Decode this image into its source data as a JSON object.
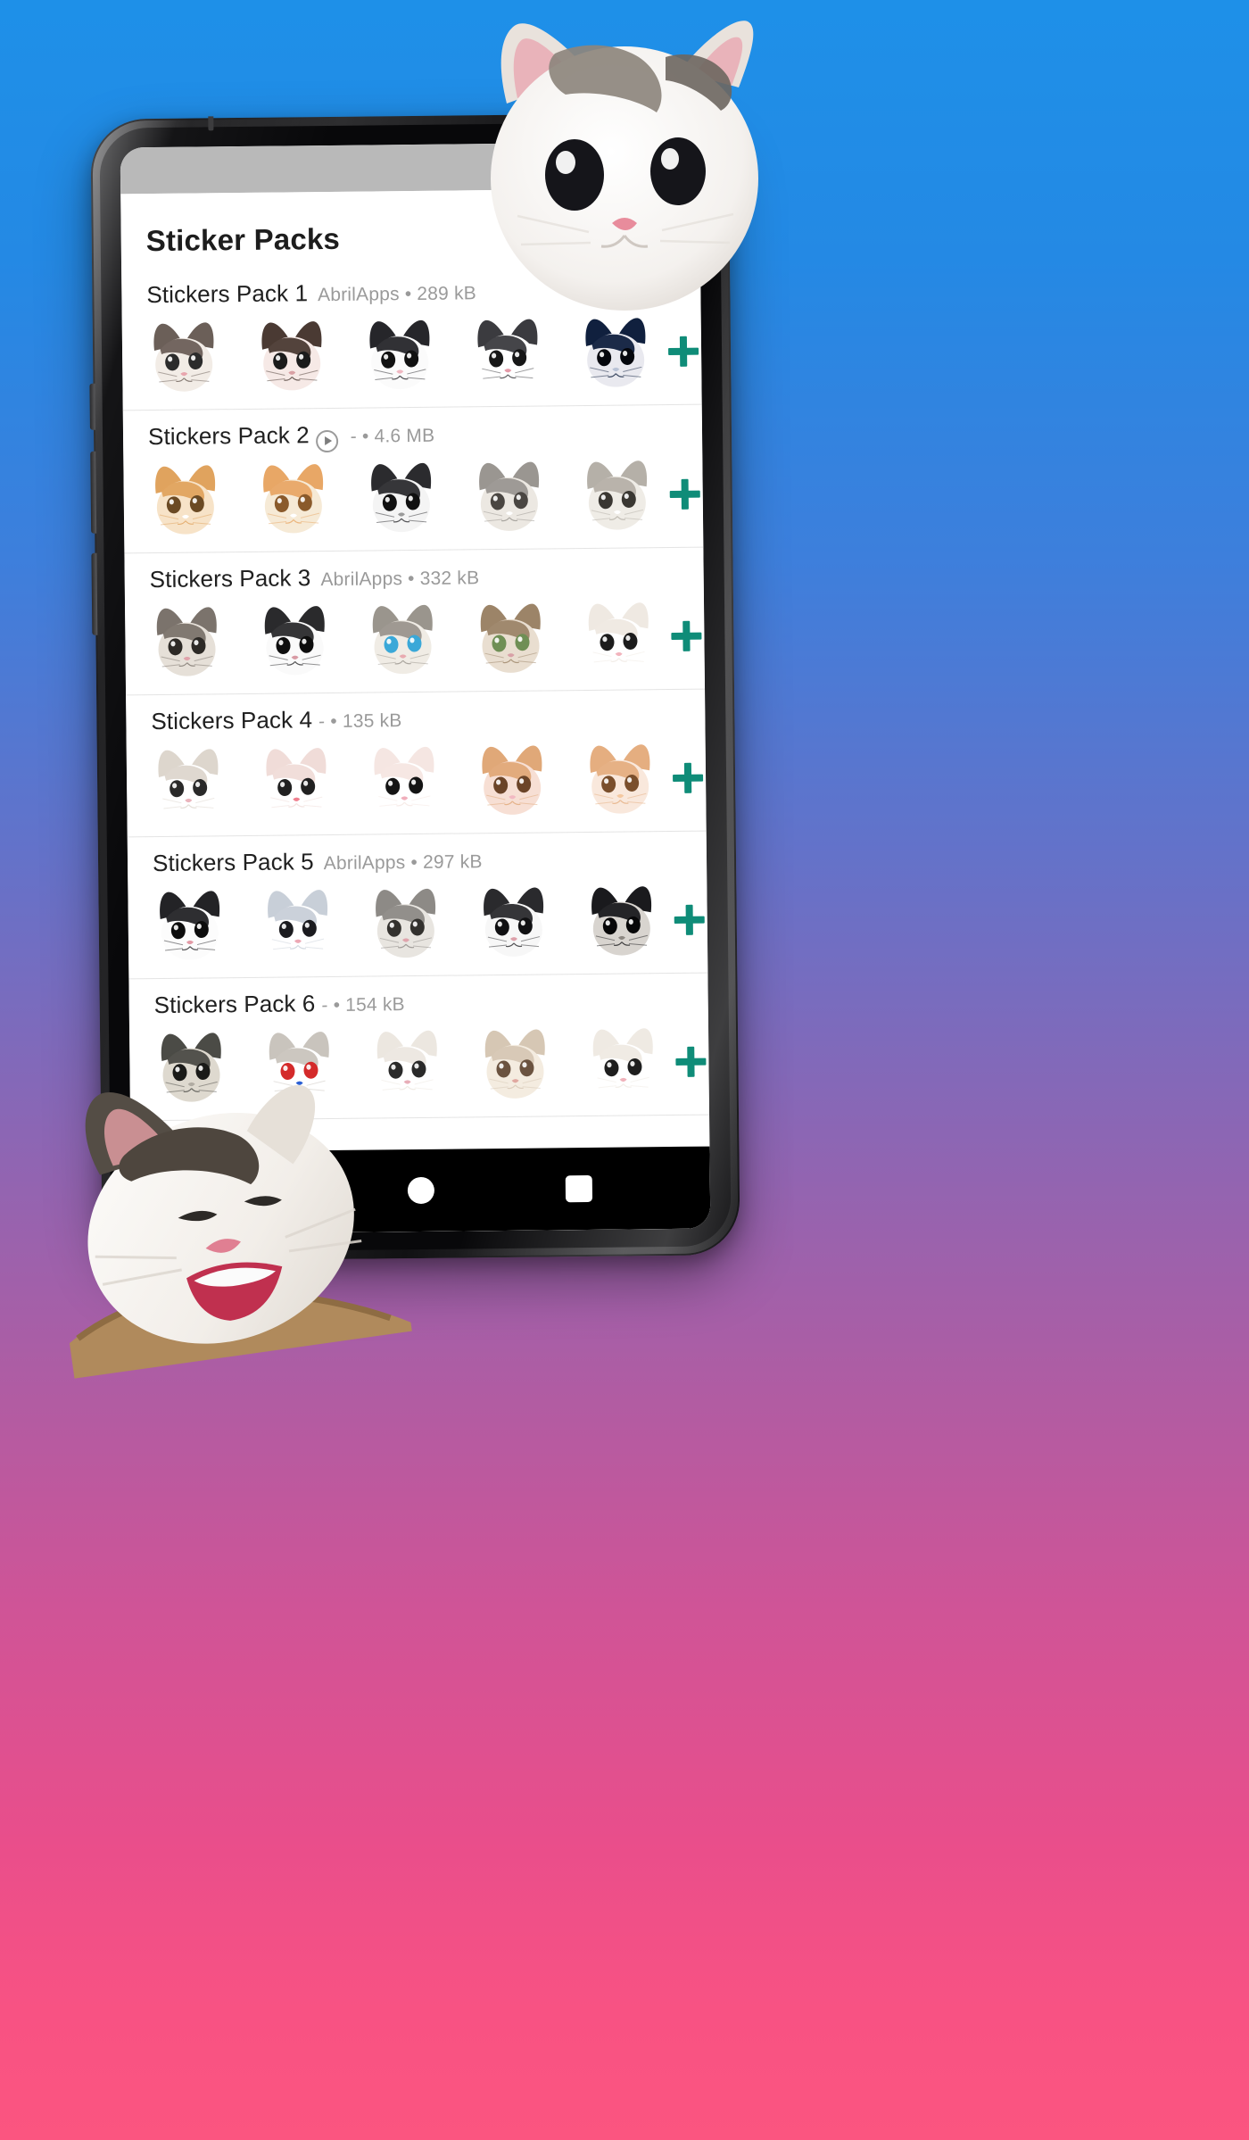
{
  "background": {
    "gradient_top": "#1E90E8",
    "gradient_mid": "#8C66B4",
    "gradient_bottom": "#FB5580"
  },
  "device": {
    "type": "android-phone-mockup",
    "frame_color": "#1D1D1F",
    "statusbar_color": "#B9B9B9"
  },
  "app": {
    "title": "Sticker Packs",
    "accent_color": "#0F8C78",
    "meta_color": "#9A9A9A"
  },
  "packs": [
    {
      "name": "Stickers Pack 1",
      "publisher": "AbrilApps",
      "separator": "•",
      "size": "289 kB",
      "meta": "AbrilApps • 289 kB",
      "animated": false,
      "add_label": "+",
      "stickers": [
        {
          "alt": "grey-and-white-kitten-sticker",
          "colors": [
            "#6b5f58",
            "#f2ece6",
            "#2b2b2b",
            "#e8a5ad"
          ]
        },
        {
          "alt": "dark-brown-kitten-wide-eyes-sticker",
          "colors": [
            "#4a3a33",
            "#f6e9e6",
            "#1b1b1b",
            "#d9a0a4"
          ]
        },
        {
          "alt": "black-and-white-cat-pink-nose-sticker",
          "colors": [
            "#26262a",
            "#fbfbfb",
            "#111111",
            "#f0b8c2"
          ]
        },
        {
          "alt": "tuxedo-cat-upright-ears-sticker",
          "colors": [
            "#3b3b3f",
            "#ffffff",
            "#171717",
            "#e59aa8"
          ]
        },
        {
          "alt": "black-cat-on-blue-background-sticker",
          "colors": [
            "#10203e",
            "#e9e9ef",
            "#05070d",
            "#b9c3d6"
          ]
        }
      ]
    },
    {
      "name": "Stickers Pack 2",
      "publisher": "-",
      "separator": "•",
      "size": "4.6 MB",
      "meta": "- • 4.6 MB",
      "animated": true,
      "animated_icon": "play-circle-icon",
      "add_label": "+",
      "stickers": [
        {
          "alt": "orange-tabby-cat-smiling-sticker",
          "colors": [
            "#e0a35e",
            "#f7e3c8",
            "#6b4a24",
            "#ffffff"
          ]
        },
        {
          "alt": "ginger-kitten-on-table-sticker",
          "colors": [
            "#e8a766",
            "#f6ead6",
            "#8a5a2b",
            "#ffffff"
          ]
        },
        {
          "alt": "tuxedo-cat-standing-sticker",
          "colors": [
            "#2b2b2e",
            "#f4f4f4",
            "#101010",
            "#9a9a9a"
          ]
        },
        {
          "alt": "grey-fluffy-cat-portrait-sticker",
          "colors": [
            "#9a9691",
            "#ece8e2",
            "#4a4642",
            "#ffffff"
          ]
        },
        {
          "alt": "pale-grey-cat-sad-eyes-sticker",
          "colors": [
            "#b5b0a8",
            "#efece6",
            "#3a3732",
            "#ffffff"
          ]
        }
      ]
    },
    {
      "name": "Stickers Pack 3",
      "publisher": "AbrilApps",
      "separator": "•",
      "size": "332 kB",
      "meta": "AbrilApps • 332 kB",
      "animated": false,
      "add_label": "+",
      "stickers": [
        {
          "alt": "grey-kitten-closeup-sticker",
          "colors": [
            "#7b736c",
            "#e6e0d8",
            "#2d2a26",
            "#e0a3ab"
          ]
        },
        {
          "alt": "black-and-white-cat-serious-sticker",
          "colors": [
            "#2a2a2c",
            "#fafafa",
            "#0e0e0e",
            "#d89aa4"
          ]
        },
        {
          "alt": "crying-cat-with-tear-sticker",
          "colors": [
            "#9a958d",
            "#f0ece5",
            "#3aa8d8",
            "#e8aab0"
          ]
        },
        {
          "alt": "tabby-cat-green-eyes-sticker",
          "colors": [
            "#9c8468",
            "#e9ded0",
            "#6f8f55",
            "#d8a0a6"
          ]
        },
        {
          "alt": "white-cat-big-eyes-sticker",
          "colors": [
            "#efe9e2",
            "#ffffff",
            "#1c1c1c",
            "#f2b4bd"
          ]
        }
      ]
    },
    {
      "name": "Stickers Pack 4",
      "publisher": "-",
      "separator": "•",
      "size": "135 kB",
      "meta": "- • 135 kB",
      "animated": false,
      "add_label": "+",
      "stickers": [
        {
          "alt": "white-kitten-peeking-sticker",
          "colors": [
            "#ddd6cd",
            "#ffffff",
            "#2a2a2a",
            "#eab4bc"
          ]
        },
        {
          "alt": "kitten-with-sparkle-eyes-sticker",
          "colors": [
            "#f0dcd8",
            "#ffffff",
            "#212121",
            "#ef7f8e"
          ]
        },
        {
          "alt": "cartoon-big-eyes-cat-sticker",
          "colors": [
            "#f5e6e2",
            "#ffffff",
            "#141414",
            "#f0aebb"
          ]
        },
        {
          "alt": "orange-cat-with-pink-blanket-sticker",
          "colors": [
            "#e0a878",
            "#f7dfd4",
            "#6b4428",
            "#f2b9c2"
          ]
        },
        {
          "alt": "orange-cat-eating-sticker",
          "colors": [
            "#e5ae80",
            "#f9e8dc",
            "#7a4f2c",
            "#f4c8a0"
          ]
        }
      ]
    },
    {
      "name": "Stickers Pack 5",
      "publisher": "AbrilApps",
      "separator": "•",
      "size": "297 kB",
      "meta": "AbrilApps • 297 kB",
      "animated": false,
      "add_label": "+",
      "stickers": [
        {
          "alt": "black-and-white-cat-face-sticker",
          "colors": [
            "#232326",
            "#fcfcfc",
            "#0d0d0d",
            "#e39aa6"
          ]
        },
        {
          "alt": "white-kitten-blue-tint-sticker",
          "colors": [
            "#c8cfd8",
            "#ffffff",
            "#1b1b1f",
            "#eda8b4"
          ]
        },
        {
          "alt": "grey-cat-grooming-sticker",
          "colors": [
            "#8d8a86",
            "#e8e5e0",
            "#33312e",
            "#dfa4ac"
          ]
        },
        {
          "alt": "black-and-white-cat-staring-sticker",
          "colors": [
            "#2a2a2d",
            "#f7f7f7",
            "#101012",
            "#dda0aa"
          ]
        },
        {
          "alt": "dark-cat-in-shadow-sticker",
          "colors": [
            "#1a1a1d",
            "#d8d4cf",
            "#070708",
            "#8c8781"
          ]
        }
      ]
    },
    {
      "name": "Stickers Pack 6",
      "publisher": "-",
      "separator": "•",
      "size": "154 kB",
      "meta": "- • 154 kB",
      "animated": false,
      "add_label": "+",
      "stickers": [
        {
          "alt": "fluffy-cat-on-dark-background-sticker",
          "colors": [
            "#4b4b46",
            "#ded9cf",
            "#1a1a18",
            "#b0aba2"
          ]
        },
        {
          "alt": "cat-with-clown-face-paint-sticker",
          "colors": [
            "#c9c4bd",
            "#ffffff",
            "#d42a2a",
            "#2a5fd4"
          ]
        },
        {
          "alt": "white-cat-with-toy-sticker",
          "colors": [
            "#ece7e0",
            "#ffffff",
            "#2a2a2a",
            "#e8aeb8"
          ]
        },
        {
          "alt": "kitten-in-striped-blanket-sticker",
          "colors": [
            "#d6c7b4",
            "#f4ece0",
            "#6b5340",
            "#e0a8a0"
          ]
        },
        {
          "alt": "white-cat-closeup-sticker",
          "colors": [
            "#efeae3",
            "#ffffff",
            "#1e1e1e",
            "#f0b2bb"
          ]
        }
      ]
    }
  ],
  "navbar": {
    "home_icon": "home-circle-icon",
    "recents_icon": "recents-square-icon"
  },
  "floating_stickers": [
    {
      "name": "cat-sticker-top-overlay",
      "alt": "white-and-grey-cat-face-large-overlay"
    },
    {
      "name": "cat-sticker-bottom-overlay",
      "alt": "calico-cat-laughing-overlay"
    }
  ]
}
